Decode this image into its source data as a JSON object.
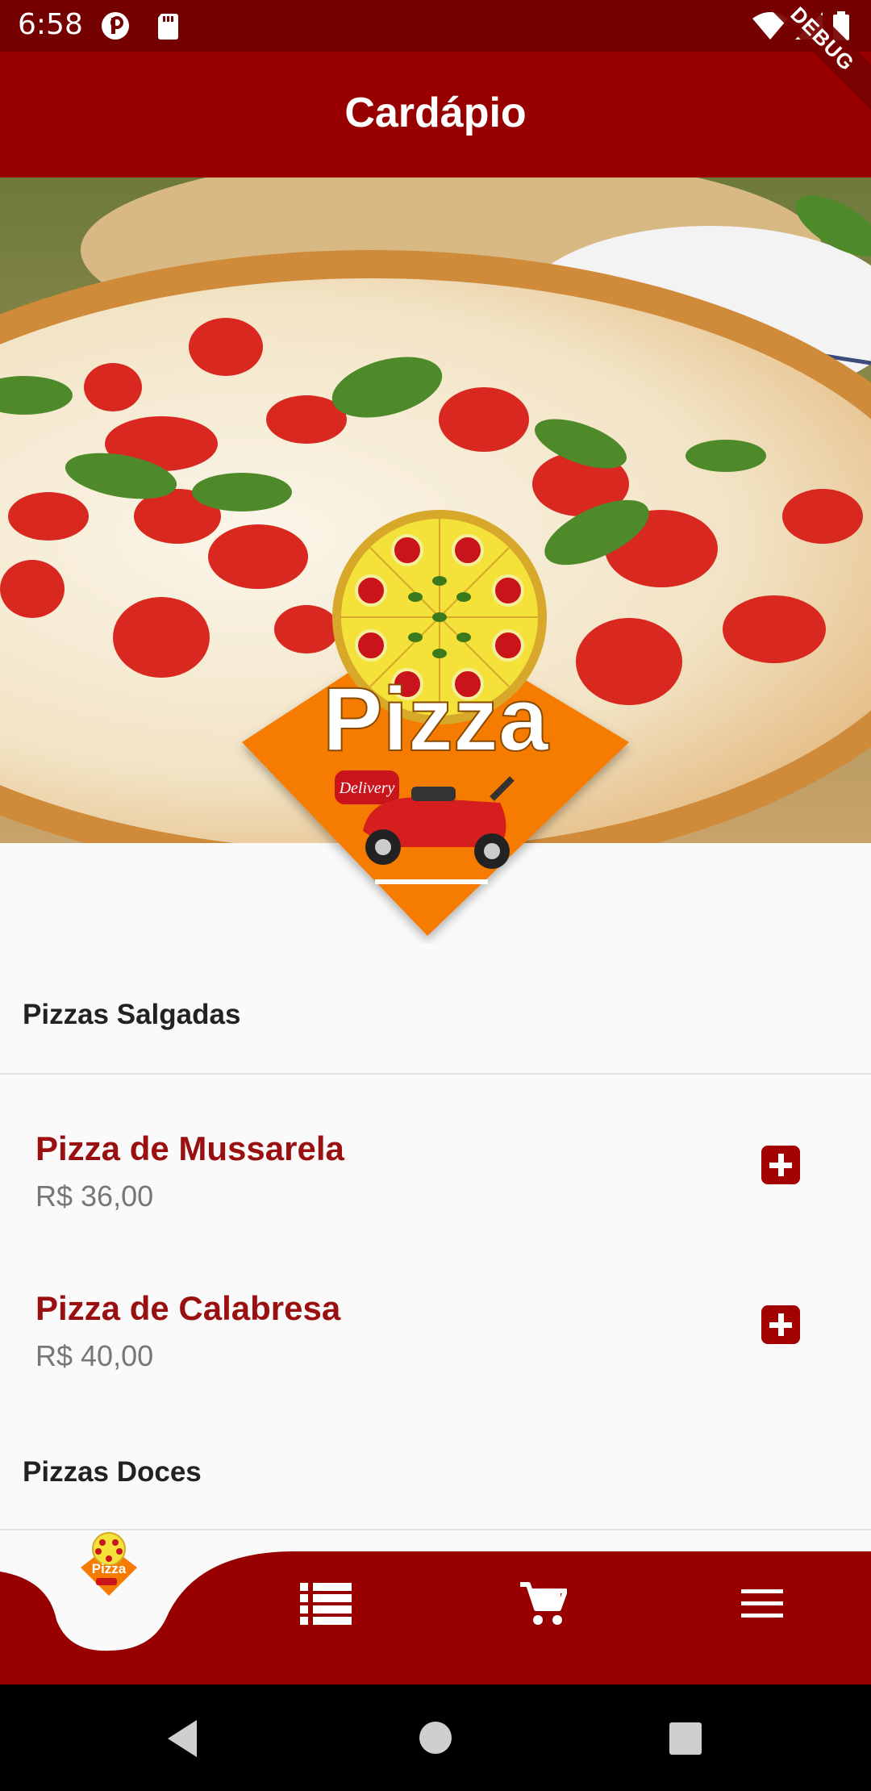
{
  "status_bar": {
    "time": "6:58",
    "icons": [
      "p-badge-icon",
      "sd-card-icon",
      "wifi-icon",
      "signal-icon",
      "battery-icon"
    ]
  },
  "app_bar": {
    "title": "Cardápio",
    "debug_label": "DEBUG"
  },
  "hero": {
    "logo_text": "Pizza",
    "logo_badge": "Delivery"
  },
  "sections": [
    {
      "title": "Pizzas Salgadas",
      "items": [
        {
          "name": "Pizza de Mussarela",
          "price": "R$ 36,00"
        },
        {
          "name": "Pizza de Calabresa",
          "price": "R$ 40,00"
        }
      ]
    },
    {
      "title": "Pizzas Doces",
      "items": []
    }
  ],
  "bottom_nav": {
    "items": [
      {
        "icon": "pizza-logo-icon",
        "logo_text": "Pizza"
      },
      {
        "icon": "list-icon"
      },
      {
        "icon": "cart-icon"
      },
      {
        "icon": "menu-icon"
      }
    ]
  },
  "android_nav": {
    "icons": [
      "back-icon",
      "home-icon",
      "recents-icon"
    ]
  },
  "colors": {
    "primary": "#980000",
    "status_bar": "#750000",
    "accent_text": "#9a0f0f",
    "logo_orange": "#f57c00"
  }
}
